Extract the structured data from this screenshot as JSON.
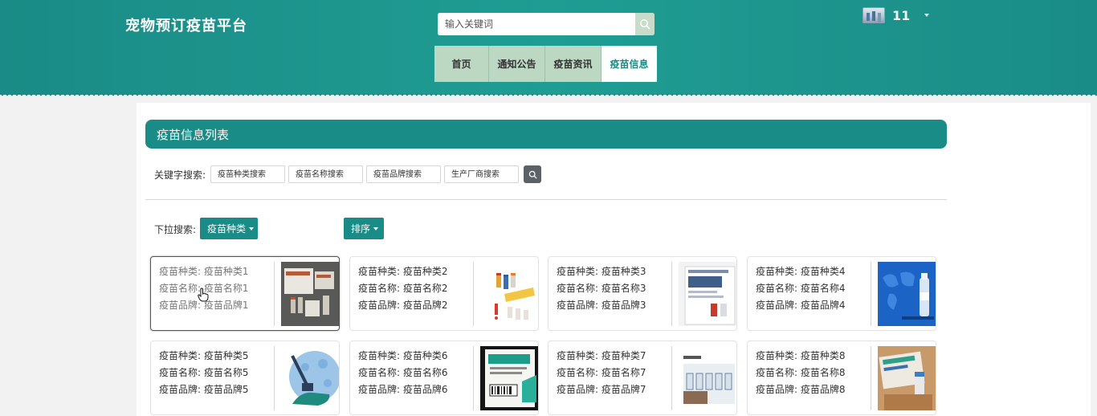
{
  "header": {
    "site_title": "宠物预订疫苗平台",
    "search_placeholder": "输入关键词",
    "search_icon": "search-icon",
    "user": {
      "name": "11",
      "avatar": "avatar-image",
      "caret_icon": "caret-down-icon"
    },
    "nav": [
      {
        "label": "首页",
        "active": false
      },
      {
        "label": "通知公告",
        "active": false
      },
      {
        "label": "疫苗资讯",
        "active": false
      },
      {
        "label": "疫苗信息",
        "active": true
      }
    ]
  },
  "panel": {
    "title": "疫苗信息列表",
    "keyword_label": "关键字搜索:",
    "keyword_inputs": [
      {
        "placeholder": "疫苗种类搜索"
      },
      {
        "placeholder": "疫苗名称搜索"
      },
      {
        "placeholder": "疫苗品牌搜索"
      },
      {
        "placeholder": "生产厂商搜索"
      }
    ],
    "dropdown_label": "下拉搜索:",
    "dropdown_category": "疫苗种类",
    "dropdown_sort": "排序"
  },
  "colors": {
    "primary": "#1a8c87",
    "nav_bg": "#bcd8c3",
    "search_btn": "#5a6268"
  },
  "items": [
    {
      "type": "疫苗种类: 疫苗种类1",
      "name": "疫苗名称: 疫苗名称1",
      "brand": "疫苗品牌: 疫苗品牌1"
    },
    {
      "type": "疫苗种类: 疫苗种类2",
      "name": "疫苗名称: 疫苗名称2",
      "brand": "疫苗品牌: 疫苗品牌2"
    },
    {
      "type": "疫苗种类: 疫苗种类3",
      "name": "疫苗名称: 疫苗名称3",
      "brand": "疫苗品牌: 疫苗品牌3"
    },
    {
      "type": "疫苗种类: 疫苗种类4",
      "name": "疫苗名称: 疫苗名称4",
      "brand": "疫苗品牌: 疫苗品牌4"
    },
    {
      "type": "疫苗种类: 疫苗种类5",
      "name": "疫苗名称: 疫苗名称5",
      "brand": "疫苗品牌: 疫苗品牌5"
    },
    {
      "type": "疫苗种类: 疫苗种类6",
      "name": "疫苗名称: 疫苗名称6",
      "brand": "疫苗品牌: 疫苗品牌6"
    },
    {
      "type": "疫苗种类: 疫苗种类7",
      "name": "疫苗名称: 疫苗名称7",
      "brand": "疫苗品牌: 疫苗品牌7"
    },
    {
      "type": "疫苗种类: 疫苗种类8",
      "name": "疫苗名称: 疫苗名称8",
      "brand": "疫苗品牌: 疫苗品牌8"
    }
  ]
}
